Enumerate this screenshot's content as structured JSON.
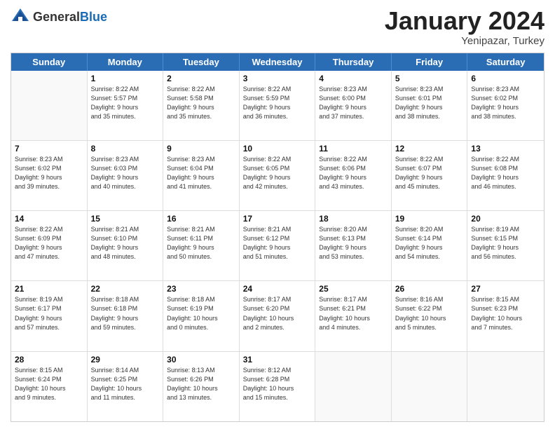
{
  "header": {
    "logo_general": "General",
    "logo_blue": "Blue",
    "month_title": "January 2024",
    "location": "Yenipazar, Turkey"
  },
  "weekdays": [
    "Sunday",
    "Monday",
    "Tuesday",
    "Wednesday",
    "Thursday",
    "Friday",
    "Saturday"
  ],
  "rows": [
    [
      {
        "day": "",
        "info": ""
      },
      {
        "day": "1",
        "info": "Sunrise: 8:22 AM\nSunset: 5:57 PM\nDaylight: 9 hours\nand 35 minutes."
      },
      {
        "day": "2",
        "info": "Sunrise: 8:22 AM\nSunset: 5:58 PM\nDaylight: 9 hours\nand 35 minutes."
      },
      {
        "day": "3",
        "info": "Sunrise: 8:22 AM\nSunset: 5:59 PM\nDaylight: 9 hours\nand 36 minutes."
      },
      {
        "day": "4",
        "info": "Sunrise: 8:23 AM\nSunset: 6:00 PM\nDaylight: 9 hours\nand 37 minutes."
      },
      {
        "day": "5",
        "info": "Sunrise: 8:23 AM\nSunset: 6:01 PM\nDaylight: 9 hours\nand 38 minutes."
      },
      {
        "day": "6",
        "info": "Sunrise: 8:23 AM\nSunset: 6:02 PM\nDaylight: 9 hours\nand 38 minutes."
      }
    ],
    [
      {
        "day": "7",
        "info": "Sunrise: 8:23 AM\nSunset: 6:02 PM\nDaylight: 9 hours\nand 39 minutes."
      },
      {
        "day": "8",
        "info": "Sunrise: 8:23 AM\nSunset: 6:03 PM\nDaylight: 9 hours\nand 40 minutes."
      },
      {
        "day": "9",
        "info": "Sunrise: 8:23 AM\nSunset: 6:04 PM\nDaylight: 9 hours\nand 41 minutes."
      },
      {
        "day": "10",
        "info": "Sunrise: 8:22 AM\nSunset: 6:05 PM\nDaylight: 9 hours\nand 42 minutes."
      },
      {
        "day": "11",
        "info": "Sunrise: 8:22 AM\nSunset: 6:06 PM\nDaylight: 9 hours\nand 43 minutes."
      },
      {
        "day": "12",
        "info": "Sunrise: 8:22 AM\nSunset: 6:07 PM\nDaylight: 9 hours\nand 45 minutes."
      },
      {
        "day": "13",
        "info": "Sunrise: 8:22 AM\nSunset: 6:08 PM\nDaylight: 9 hours\nand 46 minutes."
      }
    ],
    [
      {
        "day": "14",
        "info": "Sunrise: 8:22 AM\nSunset: 6:09 PM\nDaylight: 9 hours\nand 47 minutes."
      },
      {
        "day": "15",
        "info": "Sunrise: 8:21 AM\nSunset: 6:10 PM\nDaylight: 9 hours\nand 48 minutes."
      },
      {
        "day": "16",
        "info": "Sunrise: 8:21 AM\nSunset: 6:11 PM\nDaylight: 9 hours\nand 50 minutes."
      },
      {
        "day": "17",
        "info": "Sunrise: 8:21 AM\nSunset: 6:12 PM\nDaylight: 9 hours\nand 51 minutes."
      },
      {
        "day": "18",
        "info": "Sunrise: 8:20 AM\nSunset: 6:13 PM\nDaylight: 9 hours\nand 53 minutes."
      },
      {
        "day": "19",
        "info": "Sunrise: 8:20 AM\nSunset: 6:14 PM\nDaylight: 9 hours\nand 54 minutes."
      },
      {
        "day": "20",
        "info": "Sunrise: 8:19 AM\nSunset: 6:15 PM\nDaylight: 9 hours\nand 56 minutes."
      }
    ],
    [
      {
        "day": "21",
        "info": "Sunrise: 8:19 AM\nSunset: 6:17 PM\nDaylight: 9 hours\nand 57 minutes."
      },
      {
        "day": "22",
        "info": "Sunrise: 8:18 AM\nSunset: 6:18 PM\nDaylight: 9 hours\nand 59 minutes."
      },
      {
        "day": "23",
        "info": "Sunrise: 8:18 AM\nSunset: 6:19 PM\nDaylight: 10 hours\nand 0 minutes."
      },
      {
        "day": "24",
        "info": "Sunrise: 8:17 AM\nSunset: 6:20 PM\nDaylight: 10 hours\nand 2 minutes."
      },
      {
        "day": "25",
        "info": "Sunrise: 8:17 AM\nSunset: 6:21 PM\nDaylight: 10 hours\nand 4 minutes."
      },
      {
        "day": "26",
        "info": "Sunrise: 8:16 AM\nSunset: 6:22 PM\nDaylight: 10 hours\nand 5 minutes."
      },
      {
        "day": "27",
        "info": "Sunrise: 8:15 AM\nSunset: 6:23 PM\nDaylight: 10 hours\nand 7 minutes."
      }
    ],
    [
      {
        "day": "28",
        "info": "Sunrise: 8:15 AM\nSunset: 6:24 PM\nDaylight: 10 hours\nand 9 minutes."
      },
      {
        "day": "29",
        "info": "Sunrise: 8:14 AM\nSunset: 6:25 PM\nDaylight: 10 hours\nand 11 minutes."
      },
      {
        "day": "30",
        "info": "Sunrise: 8:13 AM\nSunset: 6:26 PM\nDaylight: 10 hours\nand 13 minutes."
      },
      {
        "day": "31",
        "info": "Sunrise: 8:12 AM\nSunset: 6:28 PM\nDaylight: 10 hours\nand 15 minutes."
      },
      {
        "day": "",
        "info": ""
      },
      {
        "day": "",
        "info": ""
      },
      {
        "day": "",
        "info": ""
      }
    ]
  ]
}
